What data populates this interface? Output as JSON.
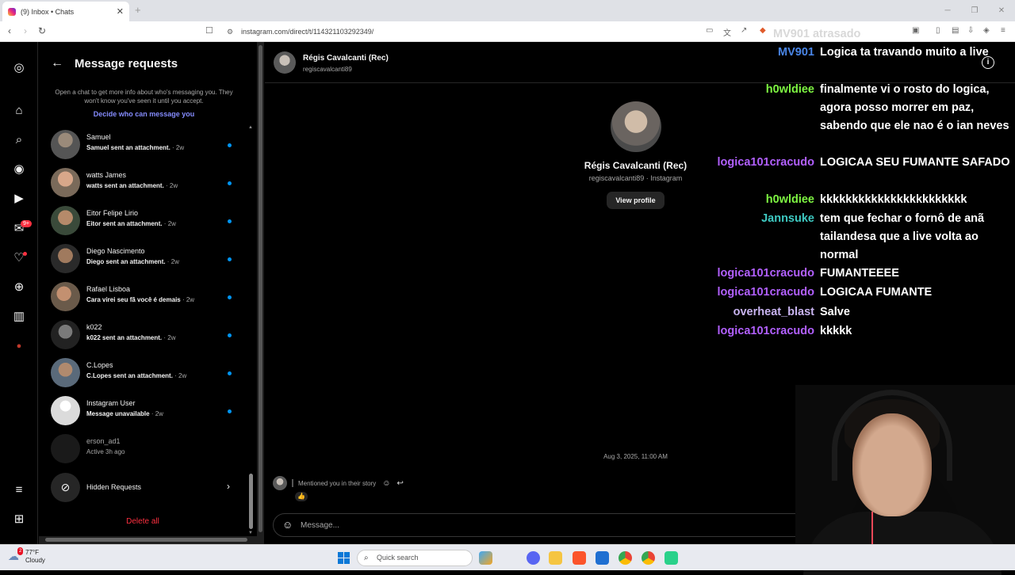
{
  "browser": {
    "tab_title": "(9) Inbox • Chats",
    "url": "instagram.com/direct/t/114321103292349/"
  },
  "sidebar": {
    "messages_badge": "9+"
  },
  "requests": {
    "title": "Message requests",
    "info": "Open a chat to get more info about who's messaging you. They won't know you've seen it until you accept.",
    "decide_link": "Decide who can message you",
    "items": [
      {
        "name": "Samuel",
        "preview": "Samuel sent an attachment.",
        "time": " · 2w"
      },
      {
        "name": "watts James",
        "preview": "watts sent an attachment.",
        "time": " · 2w"
      },
      {
        "name": "Eitor Felipe Lirio",
        "preview": "Eitor sent an attachment.",
        "time": " · 2w"
      },
      {
        "name": "Diego Nascimento",
        "preview": "Diego sent an attachment.",
        "time": " · 2w"
      },
      {
        "name": "Rafael Lisboa",
        "preview": "Cara virei seu fã você é demais",
        "time": " · 2w"
      },
      {
        "name": "k022",
        "preview": "k022 sent an attachment.",
        "time": " · 2w"
      },
      {
        "name": "C.Lopes",
        "preview": "C.Lopes sent an attachment.",
        "time": " · 2w"
      },
      {
        "name": "Instagram User",
        "preview": "Message unavailable",
        "time": " · 2w"
      },
      {
        "name": "erson_ad1",
        "preview": "Active 3h ago",
        "time": ""
      }
    ],
    "hidden_label": "Hidden Requests",
    "delete_all": "Delete all"
  },
  "chat": {
    "name": "Régis Cavalcanti (Rec)",
    "username": "regiscavalcanti89",
    "profile_sub": "regiscavalcanti89 · Instagram",
    "view_profile": "View profile",
    "date": "Aug 3, 2025, 11:00 AM",
    "story_text": "Mentioned you in their story",
    "reaction": "👍",
    "composer_placeholder": "Message..."
  },
  "stream_overlay": {
    "colors": {
      "blue": "#4a86e8",
      "green": "#7ef542",
      "teal": "#3ec9c1",
      "purple": "#b260ff",
      "lilac": "#c8b4f0"
    },
    "top_label": "MV901 atrasado",
    "lines": [
      {
        "user": "MV901",
        "color": "#4a86e8",
        "text": "Logica ta travando muito a live"
      },
      {
        "user": "h0wldiee",
        "color": "#7ef542",
        "text": "finalmente vi o rosto do logica, agora posso morrer em paz, sabendo que ele nao é o ian neves"
      },
      {
        "user": "logica101cracudo",
        "color": "#b260ff",
        "text": "LOGICAA SEU FUMANTE SAFADO"
      },
      {
        "user": "h0wldiee",
        "color": "#7ef542",
        "text": "kkkkkkkkkkkkkkkkkkkkkkk"
      },
      {
        "user": "Jannsuke",
        "color": "#3ec9c1",
        "text": "tem que fechar o fornô de anã tailandesa que a live volta ao normal"
      },
      {
        "user": "logica101cracudo",
        "color": "#b260ff",
        "text": "FUMANTEEEE"
      },
      {
        "user": "logica101cracudo",
        "color": "#b260ff",
        "text": "LOGICAA FUMANTE"
      },
      {
        "user": "overheat_blast",
        "color": "#c8b4f0",
        "text": "Salve"
      },
      {
        "user": "logica101cracudo",
        "color": "#b260ff",
        "text": "kkkkk"
      }
    ]
  },
  "taskbar": {
    "temp": "77°F",
    "condition": "Cloudy",
    "weather_badge": "2",
    "search_placeholder": "Quick search"
  }
}
